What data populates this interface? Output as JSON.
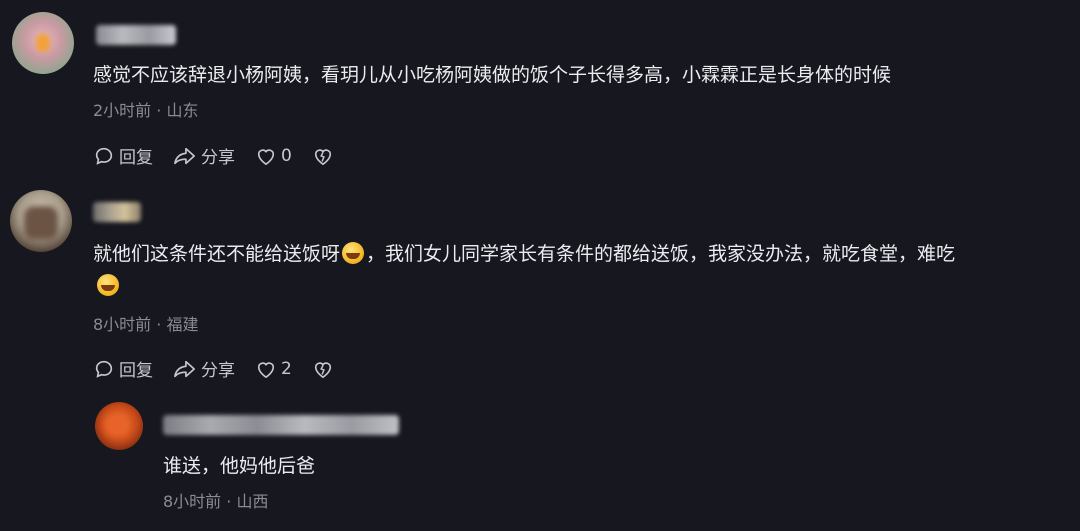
{
  "comments": [
    {
      "text": "感觉不应该辞退小杨阿姨，看玥儿从小吃杨阿姨做的饭个子长得多高，小霖霖正是长身体的时候",
      "time": "2小时前",
      "location": "山东",
      "reply_label": "回复",
      "share_label": "分享",
      "likes": "0"
    },
    {
      "text_part1": "就他们这条件还不能给送饭呀",
      "text_part2": "，我们女儿同学家长有条件的都给送饭，我家没办法，就吃食堂，难吃",
      "time": "8小时前",
      "location": "福建",
      "reply_label": "回复",
      "share_label": "分享",
      "likes": "2"
    },
    {
      "text": "谁送，他妈他后爸",
      "time": "8小时前",
      "location": "山西"
    }
  ],
  "separator": "·",
  "colors": {
    "background": "#16171f",
    "meta": "#8a8b94"
  },
  "icons": [
    "reply-icon",
    "share-icon",
    "heart-icon",
    "dislike-heart-icon",
    "laughing-emoji"
  ]
}
